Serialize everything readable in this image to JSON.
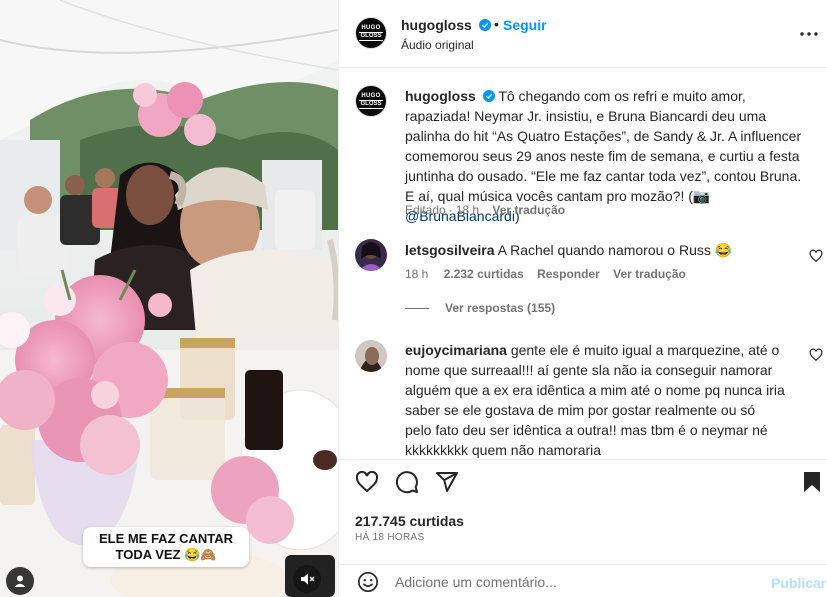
{
  "post": {
    "username": "hugogloss",
    "logo_line1": "HUGO",
    "logo_line2": "GLOSS",
    "separator": "•",
    "follow_label": "Seguir",
    "audio_label": "Áudio original",
    "more_icon": "more-horizontal-icon",
    "verified_icon": "verified-badge-icon"
  },
  "media": {
    "overlay_caption": "ELE ME FAZ CANTAR TODA VEZ 😂🙈",
    "user_icon": "user-tag-icon",
    "mute_icon": "speaker-muted-icon"
  },
  "caption": {
    "username": "hugogloss",
    "text": "Tô chegando com os refri e muito amor, rapaziada! Neymar Jr. insistiu, e Bruna Biancardi deu uma palinha do hit “As Quatro Estações”, de Sandy & Jr. A influencer comemorou seus 29 anos neste fim de semana, e curtiu a festa juntinha do ousado. “Ele me faz cantar toda vez”, contou Bruna. E aí, qual música vocês cantam pro mozão?! (📷 ",
    "mention": "@BrunaBiancardi",
    "text_end": ")",
    "edited": "Editado",
    "time": "18 h",
    "see_translation": "Ver tradução"
  },
  "comments": [
    {
      "username": "letsgosilveira",
      "text": "A Rachel quando namorou o Russ 😂",
      "time": "18 h",
      "likes": "2.232 curtidas",
      "reply": "Responder",
      "see_translation": "Ver tradução",
      "view_replies": "Ver respostas (155)"
    },
    {
      "username": "eujoycimariana",
      "text": "gente ele é muito igual a marquezine, até o nome que surreaal!!! aí gente sla não ia conseguir namorar alguém que a ex era idêntica a mim até o nome pq nunca iria saber se ele gostava de mim por gostar realmente ou só pelo fato deu ser idêntica a outra!! mas tbm é o neymar né kkkkkkkkk quem não namoraria"
    }
  ],
  "actions": {
    "icons": [
      "heart-icon",
      "comment-icon",
      "share-icon",
      "bookmark-icon"
    ],
    "likes": "217.745 curtidas",
    "timestamp": "HÁ 18 HORAS"
  },
  "add_comment": {
    "placeholder": "Adicione um comentário...",
    "publish_label": "Publicar",
    "emoji_icon": "emoji-icon"
  },
  "colors": {
    "link_blue": "#0095f6",
    "mention_blue": "#00376b",
    "muted_text": "#737373",
    "publish_disabled": "#b2dffc",
    "verified_blue": "#0095f6"
  }
}
